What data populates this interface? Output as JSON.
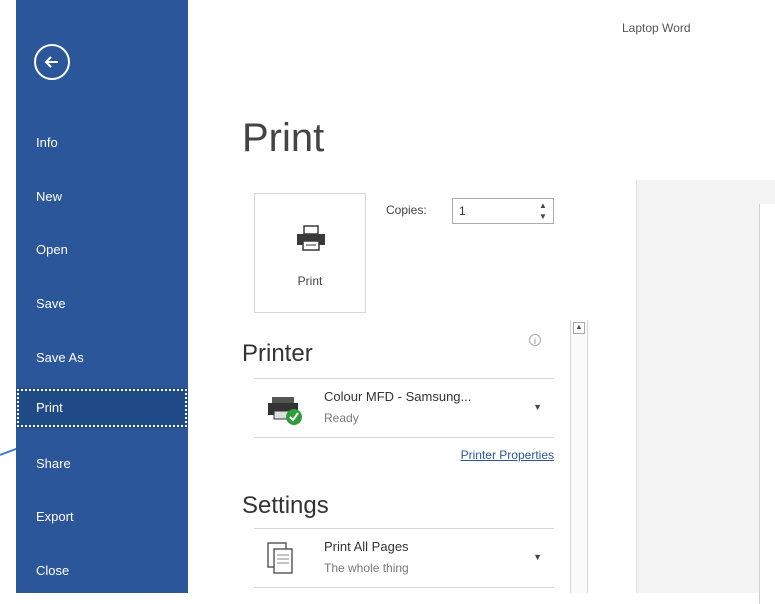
{
  "window": {
    "title_fragment": "Laptop  Word"
  },
  "sidebar": {
    "items": [
      {
        "label": "Info"
      },
      {
        "label": "New"
      },
      {
        "label": "Open"
      },
      {
        "label": "Save"
      },
      {
        "label": "Save As"
      },
      {
        "label": "Print",
        "active": true
      },
      {
        "label": "Share"
      },
      {
        "label": "Export"
      },
      {
        "label": "Close"
      }
    ]
  },
  "page": {
    "title": "Print"
  },
  "print_button": {
    "label": "Print",
    "icon": "printer-icon"
  },
  "copies": {
    "label": "Copies:",
    "value": "1"
  },
  "printer": {
    "heading": "Printer",
    "name": "Colour MFD - Samsung...",
    "status": "Ready",
    "icon": "network-printer-icon",
    "properties_link": "Printer Properties"
  },
  "settings": {
    "heading": "Settings",
    "option": "Print All Pages",
    "option_sub": "The whole thing",
    "icon": "pages-icon"
  },
  "colors": {
    "sidebar": "#2b579a",
    "active": "#1f4a86",
    "link": "#2b579a",
    "arrow": "#3b7fd0"
  }
}
